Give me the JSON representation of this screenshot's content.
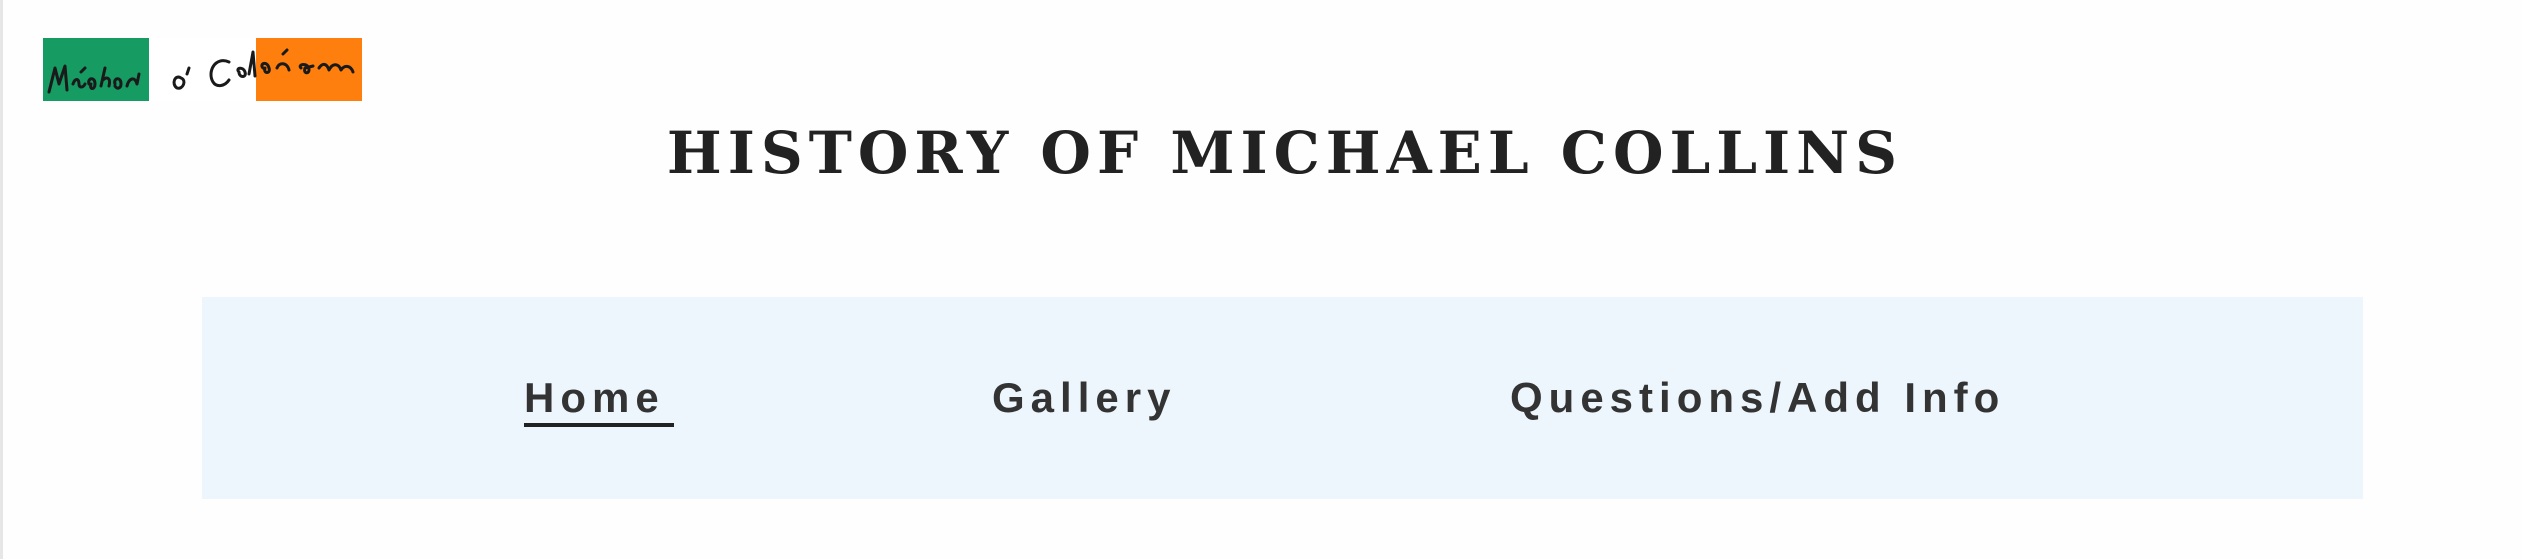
{
  "logo": {
    "signature_text": "Mícheál Ó Coileáin",
    "colors": {
      "green": "#169b62",
      "white": "#ffffff",
      "orange": "#ff7f0e"
    }
  },
  "header": {
    "title": "HISTORY OF MICHAEL COLLINS"
  },
  "nav": {
    "items": [
      {
        "label": "Home",
        "active": true
      },
      {
        "label": "Gallery",
        "active": false
      },
      {
        "label": "Questions/Add Info",
        "active": false
      }
    ],
    "background": "#eef6fd"
  }
}
